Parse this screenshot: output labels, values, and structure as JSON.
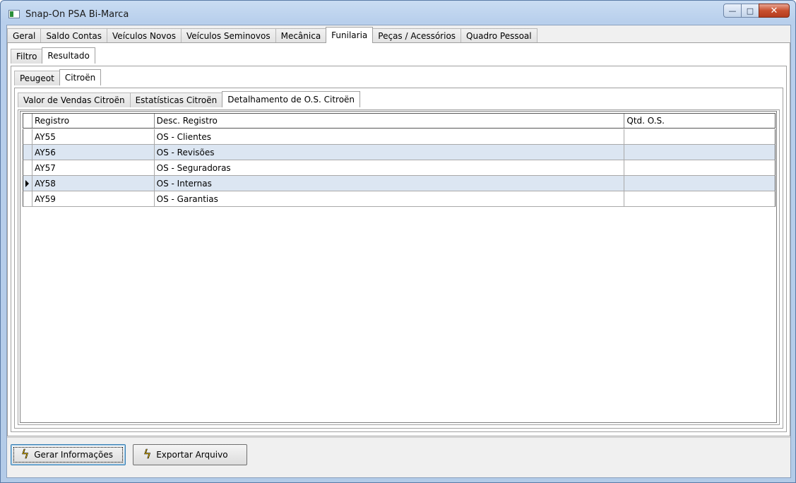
{
  "window": {
    "title": "Snap-On PSA Bi-Marca",
    "controls": {
      "minimize_glyph": "—",
      "maximize_glyph": "□",
      "close_glyph": "✕"
    }
  },
  "main_tabs": {
    "items": [
      {
        "label": "Geral"
      },
      {
        "label": "Saldo Contas"
      },
      {
        "label": "Veículos Novos"
      },
      {
        "label": "Veículos Seminovos"
      },
      {
        "label": "Mecânica"
      },
      {
        "label": "Funilaria",
        "active": true
      },
      {
        "label": "Peças / Acessórios"
      },
      {
        "label": "Quadro Pessoal"
      }
    ]
  },
  "sub_tabs": {
    "items": [
      {
        "label": "Filtro"
      },
      {
        "label": "Resultado",
        "active": true
      }
    ]
  },
  "brand_tabs": {
    "items": [
      {
        "label": "Peugeot"
      },
      {
        "label": "Citroën",
        "active": true
      }
    ]
  },
  "report_tabs": {
    "items": [
      {
        "label": "Valor de Vendas Citroën"
      },
      {
        "label": "Estatísticas Citroën"
      },
      {
        "label": "Detalhamento de O.S. Citroën",
        "active": true
      }
    ]
  },
  "grid": {
    "columns": [
      "Registro",
      "Desc. Registro",
      "Qtd. O.S."
    ],
    "rows": [
      {
        "registro": "AY55",
        "desc": "OS - Clientes",
        "qtd": ""
      },
      {
        "registro": "AY56",
        "desc": "OS - Revisões",
        "qtd": ""
      },
      {
        "registro": "AY57",
        "desc": "OS - Seguradoras",
        "qtd": ""
      },
      {
        "registro": "AY58",
        "desc": "OS - Internas",
        "qtd": "",
        "current": true
      },
      {
        "registro": "AY59",
        "desc": "OS - Garantias",
        "qtd": ""
      }
    ]
  },
  "actions": {
    "generate_label": "Gerar Informações",
    "export_label": "Exportar Arquivo",
    "icon": "lightning-bolt-icon"
  }
}
